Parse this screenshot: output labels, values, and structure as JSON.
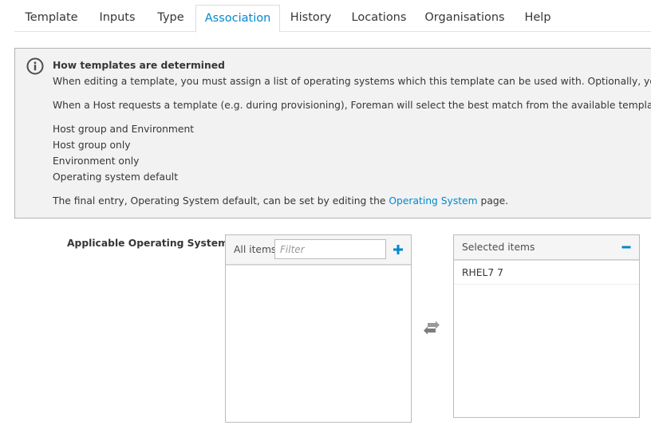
{
  "tabs": [
    {
      "label": "Template"
    },
    {
      "label": "Inputs"
    },
    {
      "label": "Type"
    },
    {
      "label": "Association",
      "active": true
    },
    {
      "label": "History"
    },
    {
      "label": "Locations"
    },
    {
      "label": "Organisations"
    },
    {
      "label": "Help"
    }
  ],
  "info": {
    "icon": "info-icon",
    "title": "How templates are determined",
    "para1": "When editing a template, you must assign a list of operating systems which this template can be used with. Optionally, you can restrict",
    "para2": "When a Host requests a template (e.g. during provisioning), Foreman will select the best match from the available templates of that typ",
    "items": [
      "Host group and Environment",
      "Host group only",
      "Environment only",
      "Operating system default"
    ],
    "final_before": "The final entry, Operating System default, can be set by editing the",
    "final_link": "Operating System",
    "final_after": "page."
  },
  "association": {
    "label": "Applicable Operating Systems",
    "all_items_label": "All items",
    "filter_placeholder": "Filter",
    "add_icon": "plus-icon",
    "swap_icon": "swap-arrows-icon",
    "selected_label": "Selected items",
    "remove_icon": "minus-icon",
    "selected_items": [
      "RHEL7 7"
    ]
  },
  "colors": {
    "accent": "#0088ce",
    "alert_bg": "#f2f2f2",
    "text": "#363636"
  }
}
